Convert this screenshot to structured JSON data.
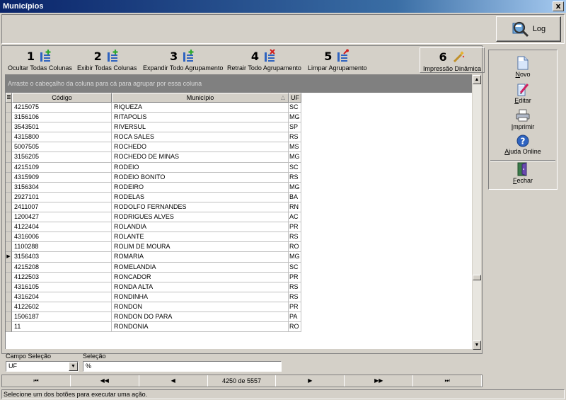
{
  "window": {
    "title": "Municípios",
    "close_label": "x"
  },
  "log_button": {
    "label": "Log"
  },
  "toolbar": {
    "buttons": [
      {
        "number": "1",
        "label": "Ocultar Todas Colunas"
      },
      {
        "number": "2",
        "label": "Exibir Todas  Colunas"
      },
      {
        "number": "3",
        "label": "Expandir Todo Agrupamento"
      },
      {
        "number": "4",
        "label": "Retrair Todo Agrupamento"
      },
      {
        "number": "5",
        "label": "Limpar Agrupamento"
      },
      {
        "number": "6",
        "label": "Impressão Dinâmica"
      }
    ]
  },
  "grid": {
    "group_hint": "Arraste o cabeçalho da coluna para cá para agrupar por essa coluna",
    "columns": [
      "Código",
      "Município",
      "UF"
    ],
    "sort_indicator": "△",
    "current_row_marker": "▶",
    "rows": [
      [
        "4215075",
        "RIQUEZA",
        "SC"
      ],
      [
        "3156106",
        "RITAPOLIS",
        "MG"
      ],
      [
        "3543501",
        "RIVERSUL",
        "SP"
      ],
      [
        "4315800",
        "ROCA SALES",
        "RS"
      ],
      [
        "5007505",
        "ROCHEDO",
        "MS"
      ],
      [
        "3156205",
        "ROCHEDO DE MINAS",
        "MG"
      ],
      [
        "4215109",
        "RODEIO",
        "SC"
      ],
      [
        "4315909",
        "RODEIO BONITO",
        "RS"
      ],
      [
        "3156304",
        "RODEIRO",
        "MG"
      ],
      [
        "2927101",
        "RODELAS",
        "BA"
      ],
      [
        "2411007",
        "RODOLFO FERNANDES",
        "RN"
      ],
      [
        "1200427",
        "RODRIGUES ALVES",
        "AC"
      ],
      [
        "4122404",
        "ROLANDIA",
        "PR"
      ],
      [
        "4316006",
        "ROLANTE",
        "RS"
      ],
      [
        "1100288",
        "ROLIM DE MOURA",
        "RO"
      ],
      [
        "3156403",
        "ROMARIA",
        "MG"
      ],
      [
        "4215208",
        "ROMELANDIA",
        "SC"
      ],
      [
        "4122503",
        "RONCADOR",
        "PR"
      ],
      [
        "4316105",
        "RONDA ALTA",
        "RS"
      ],
      [
        "4316204",
        "RONDINHA",
        "RS"
      ],
      [
        "4122602",
        "RONDON",
        "PR"
      ],
      [
        "1506187",
        "RONDON DO PARA",
        "PA"
      ],
      [
        "11",
        "RONDONIA",
        "RO"
      ]
    ],
    "current_row_index": 15
  },
  "filter": {
    "campo_label": "Campo Seleção",
    "campo_value": "UF",
    "selecao_label": "Seleção",
    "selecao_value": "%"
  },
  "navigator": {
    "first": "⏮",
    "prev_page": "◀◀",
    "prev": "◀",
    "position": "4250 de 5557",
    "next": "▶",
    "next_page": "▶▶",
    "last": "⏭"
  },
  "side_actions": [
    {
      "label": "Novo",
      "underline": "N",
      "rest": "ovo",
      "icon": "new-document-icon"
    },
    {
      "label": "Editar",
      "underline": "E",
      "rest": "ditar",
      "icon": "edit-document-icon"
    },
    {
      "label": "Imprimir",
      "underline": "I",
      "rest": "mprimir",
      "icon": "printer-icon"
    },
    {
      "label": "Ajuda Online",
      "underline": "A",
      "rest": "juda Online",
      "icon": "help-icon"
    },
    {
      "label": "Fechar",
      "underline": "F",
      "rest": "echar",
      "icon": "exit-door-icon"
    }
  ],
  "status_bar": {
    "text": "Selecione um dos botões para executar uma ação."
  },
  "colors": {
    "title_bar": "#0a246a",
    "group_bar": "#808080",
    "face": "#d4d0c8",
    "icon_blue": "#2e63c0",
    "icon_green": "#2fa82f",
    "icon_red": "#d02020"
  }
}
